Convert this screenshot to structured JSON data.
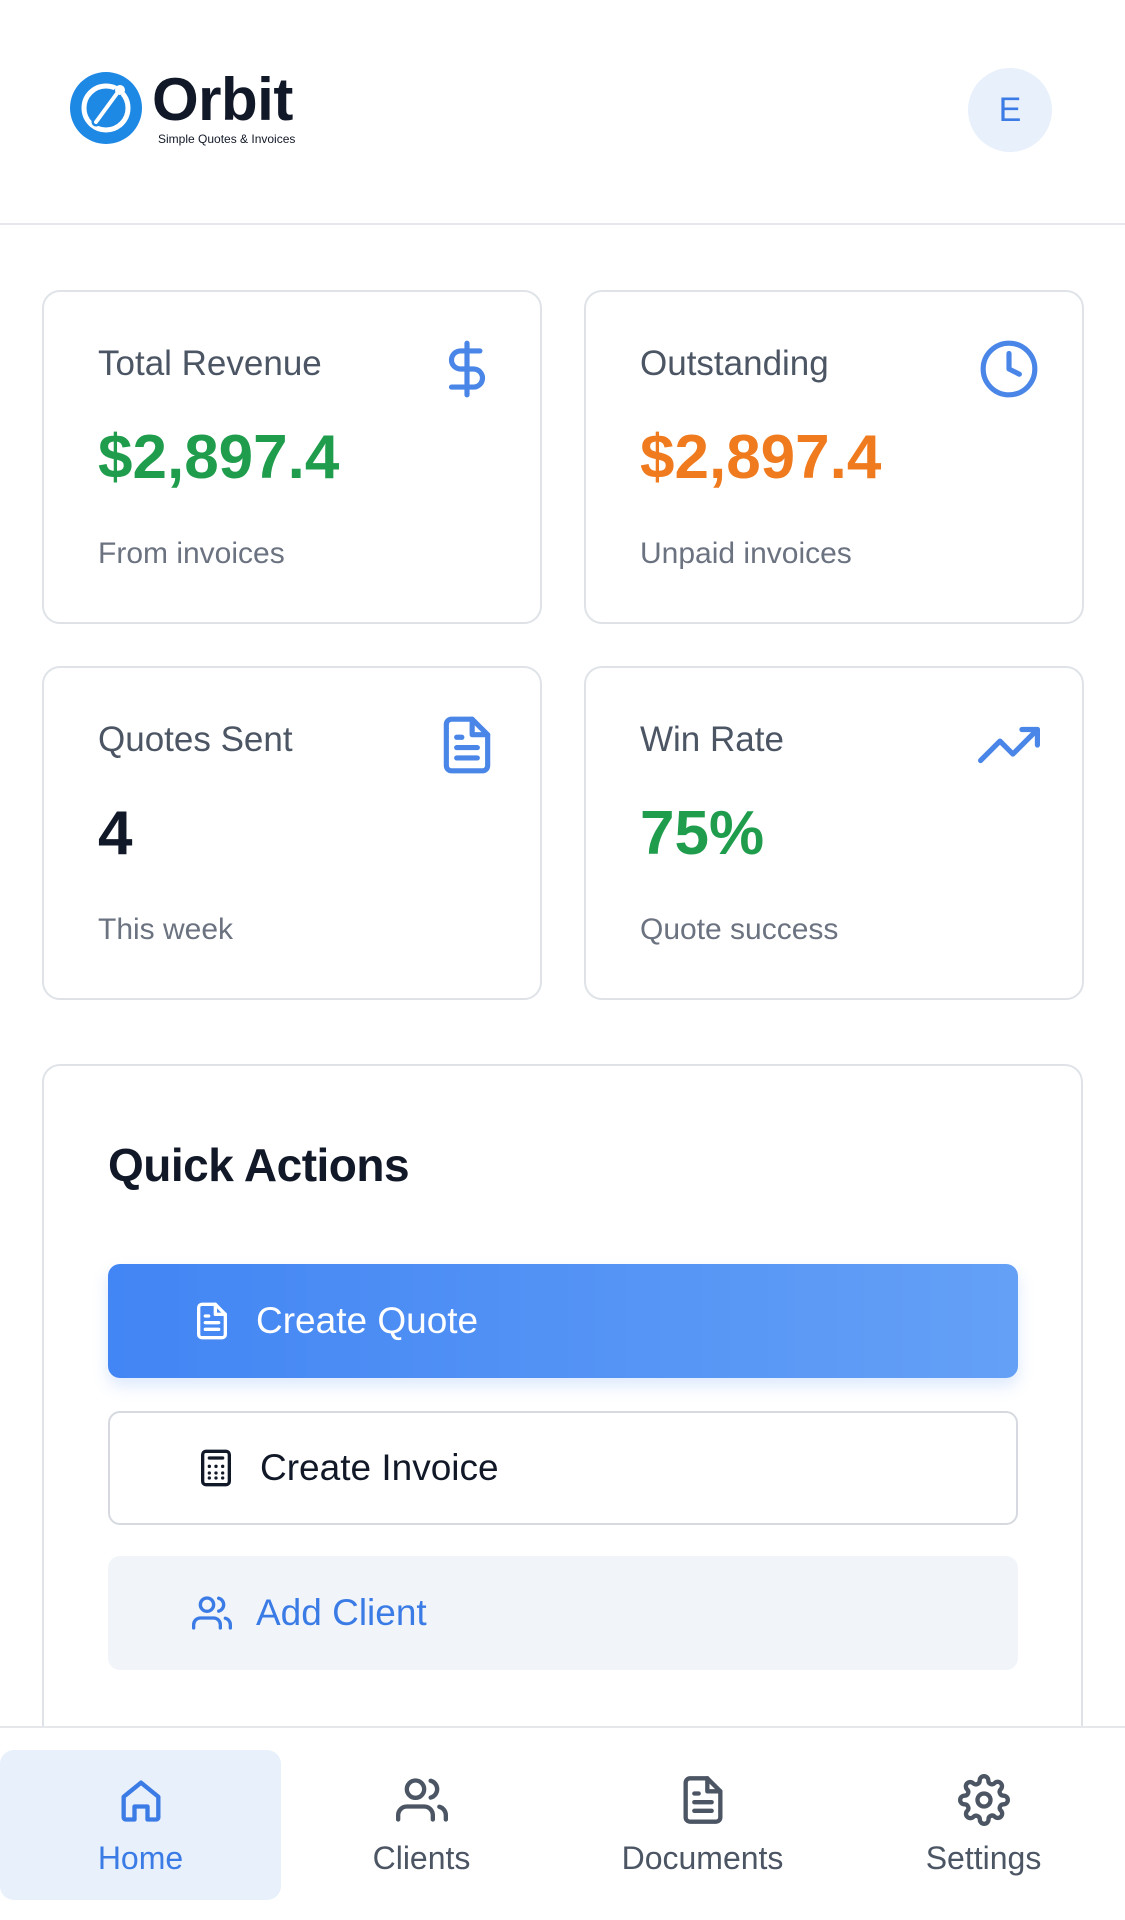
{
  "header": {
    "logo_name": "Orbit",
    "logo_tagline": "Simple Quotes & Invoices",
    "avatar_initial": "E"
  },
  "stats": {
    "total_revenue": {
      "label": "Total Revenue",
      "value": "$2,897.4",
      "sub": "From invoices",
      "icon": "dollar-icon",
      "color": "#1f9d4c"
    },
    "outstanding": {
      "label": "Outstanding",
      "value": "$2,897.4",
      "sub": "Unpaid invoices",
      "icon": "clock-icon",
      "color": "#f07b1f"
    },
    "quotes_sent": {
      "label": "Quotes Sent",
      "value": "4",
      "sub": "This week",
      "icon": "document-icon",
      "color": "#111827"
    },
    "win_rate": {
      "label": "Win Rate",
      "value": "75%",
      "sub": "Quote success",
      "icon": "trending-up-icon",
      "color": "#1f9d4c"
    }
  },
  "quick_actions": {
    "title": "Quick Actions",
    "create_quote": "Create Quote",
    "create_invoice": "Create Invoice",
    "add_client": "Add Client"
  },
  "nav": {
    "home": "Home",
    "clients": "Clients",
    "documents": "Documents",
    "settings": "Settings",
    "active": "home"
  },
  "colors": {
    "accent": "#3b7be6",
    "primary_button": "#4285f4",
    "success": "#1f9d4c",
    "warning": "#f07b1f"
  }
}
